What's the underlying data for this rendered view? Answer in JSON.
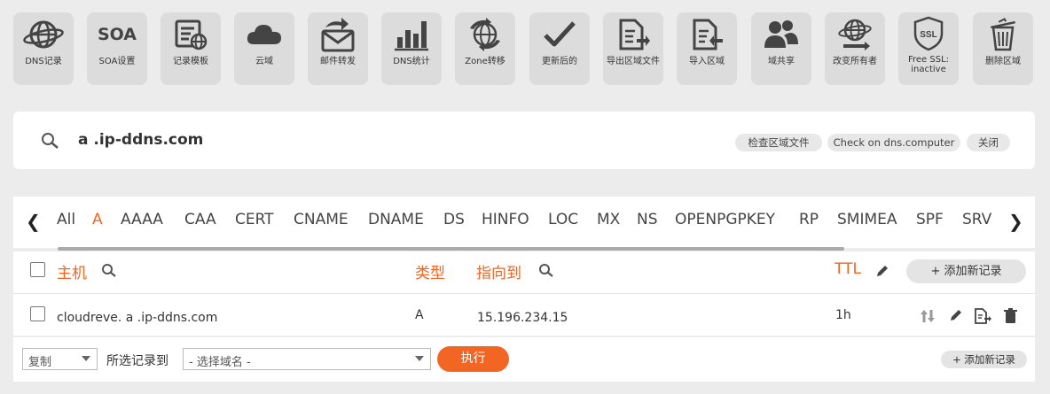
{
  "toolbar": [
    {
      "label": "DNS记录",
      "icon": "globe-icon"
    },
    {
      "label": "SOA设置",
      "icon": "soa-text-icon"
    },
    {
      "label": "记录模板",
      "icon": "template-icon"
    },
    {
      "label": "云域",
      "icon": "cloud-icon"
    },
    {
      "label": "邮件转发",
      "icon": "mail-forward-icon"
    },
    {
      "label": "DNS统计",
      "icon": "bar-chart-icon"
    },
    {
      "label": "Zone转移",
      "icon": "globe-transfer-icon"
    },
    {
      "label": "更新后的",
      "icon": "checkmark-icon"
    },
    {
      "label": "导出区域文件",
      "icon": "file-export-icon"
    },
    {
      "label": "导入区域",
      "icon": "file-import-icon"
    },
    {
      "label": "域共享",
      "icon": "users-icon"
    },
    {
      "label": "改变所有者",
      "icon": "globe-arrow-icon"
    },
    {
      "label": "Free SSL: inactive",
      "icon": "ssl-shield-icon"
    },
    {
      "label": "删除区域",
      "icon": "trash-bin-icon"
    }
  ],
  "soa_icon_text": "SOA",
  "ssl_icon_text": "SSL",
  "search": {
    "domain": "a .ip-ddns.com",
    "check_zone_label": "检查区域文件",
    "check_dns_label": "Check on dns.computer",
    "close_label": "关闭"
  },
  "record_tabs": [
    "All",
    "A",
    "AAAA",
    "CAA",
    "CERT",
    "CNAME",
    "DNAME",
    "DS",
    "HINFO",
    "LOC",
    "MX",
    "NS",
    "OPENPGPKEY",
    "RP",
    "SMIMEA",
    "SPF",
    "SRV"
  ],
  "active_tab": "A",
  "table": {
    "col_host": "主机",
    "col_type": "类型",
    "col_points_to": "指向到",
    "col_ttl": "TTL",
    "add_record_label": "+ 添加新记录",
    "rows": [
      {
        "host": "cloudreve. a .ip-ddns.com",
        "type": "A",
        "points_to": "15.196.234.15",
        "ttl": "1h"
      }
    ]
  },
  "footer": {
    "action_select": "复制",
    "move_label": "所选记录到",
    "domain_select": "- 选择域名 -",
    "execute_label": "执行",
    "add_record_label": "+ 添加新记录"
  },
  "colors": {
    "accent": "#f26522",
    "tile": "#dcdcdc",
    "background": "#ececec"
  }
}
